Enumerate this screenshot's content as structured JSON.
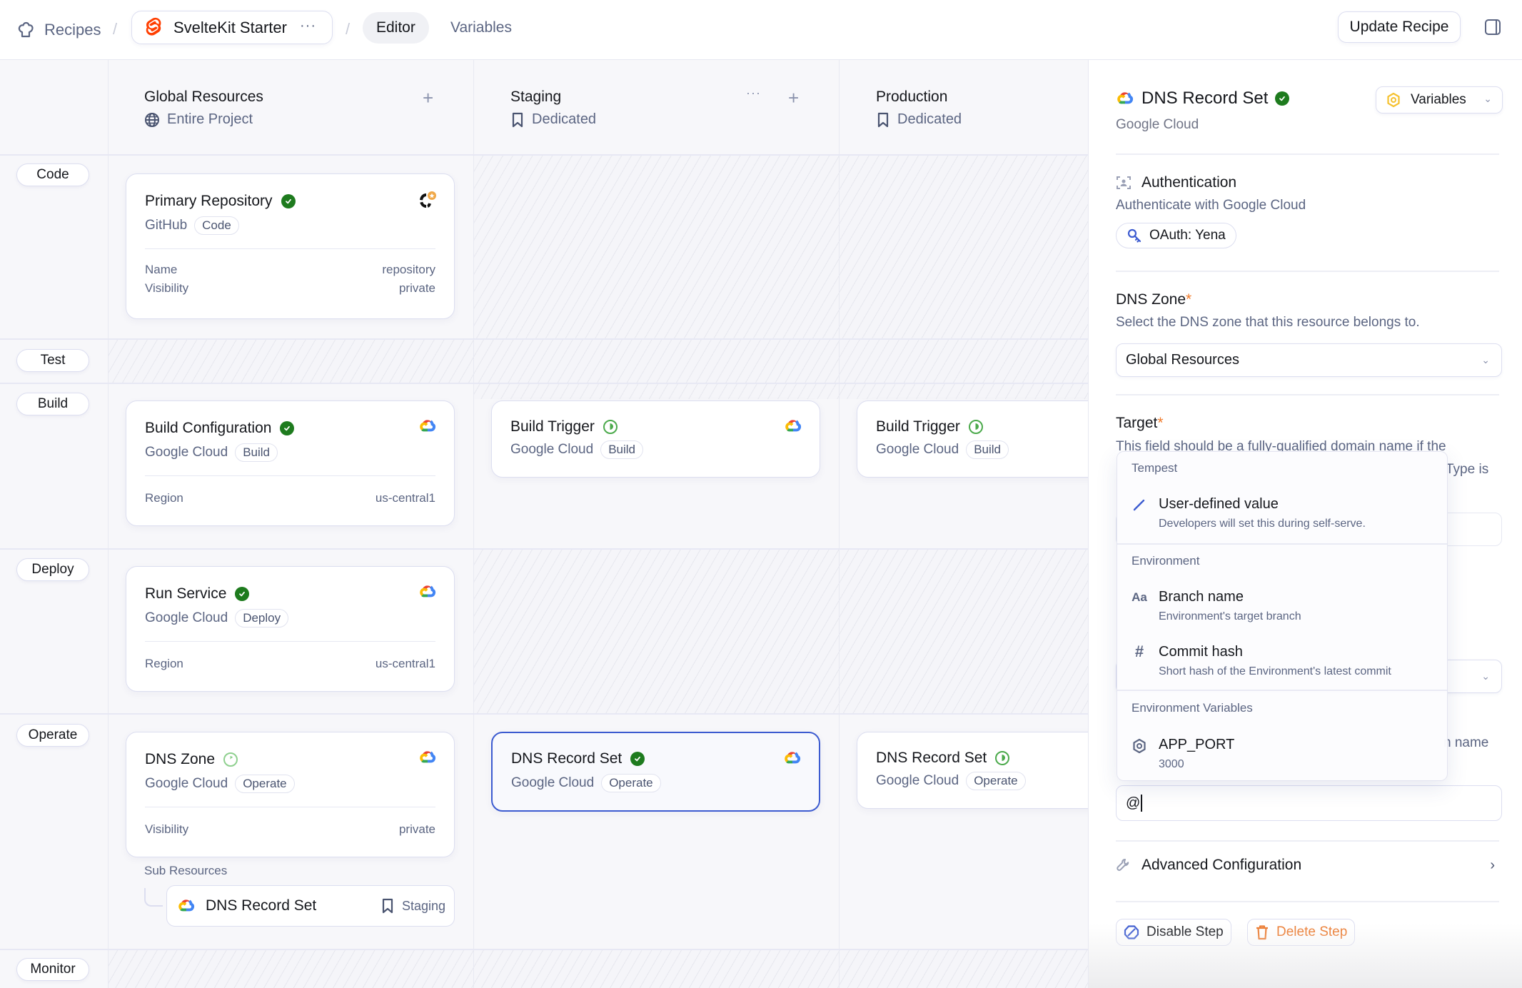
{
  "topbar": {
    "breadcrumb_root": "Recipes",
    "project_name": "SvelteKit Starter",
    "project_menu": "···",
    "separator": "/",
    "tabs": [
      {
        "label": "Editor",
        "active": true
      },
      {
        "label": "Variables",
        "active": false
      }
    ],
    "update_button": "Update Recipe"
  },
  "columns": [
    {
      "title": "Global Resources",
      "subtitle": "Entire Project",
      "icon": "globe-icon",
      "add": "+"
    },
    {
      "title": "Staging",
      "subtitle": "Dedicated",
      "icon": "bookmark-icon",
      "more": "···",
      "add": "+"
    },
    {
      "title": "Production",
      "subtitle": "Dedicated",
      "icon": "bookmark-icon"
    }
  ],
  "rows": [
    "Code",
    "Test",
    "Build",
    "Deploy",
    "Operate",
    "Monitor"
  ],
  "cards": {
    "primary_repo": {
      "title": "Primary Repository",
      "status": "done",
      "provider": "GitHub",
      "tag": "Code",
      "props": [
        {
          "label": "Name",
          "value": "repository"
        },
        {
          "label": "Visibility",
          "value": "private"
        }
      ]
    },
    "build_config": {
      "title": "Build Configuration",
      "status": "done",
      "provider": "Google Cloud",
      "tag": "Build",
      "props": [
        {
          "label": "Region",
          "value": "us-central1"
        }
      ]
    },
    "build_trigger_staging": {
      "title": "Build Trigger",
      "status": "in-progress",
      "provider": "Google Cloud",
      "tag": "Build"
    },
    "build_trigger_production": {
      "title": "Build Trigger",
      "status": "in-progress",
      "provider": "Google Cloud",
      "tag": "Build"
    },
    "run_service": {
      "title": "Run Service",
      "status": "done",
      "provider": "Google Cloud",
      "tag": "Deploy",
      "props": [
        {
          "label": "Region",
          "value": "us-central1"
        }
      ]
    },
    "dns_zone": {
      "title": "DNS Zone",
      "status": "pending",
      "provider": "Google Cloud",
      "tag": "Operate",
      "props": [
        {
          "label": "Visibility",
          "value": "private"
        }
      ]
    },
    "dns_record_staging": {
      "title": "DNS Record Set",
      "status": "done",
      "provider": "Google Cloud",
      "tag": "Operate",
      "selected": true
    },
    "dns_record_production": {
      "title": "DNS Record Set",
      "status": "in-progress",
      "provider": "Google Cloud",
      "tag": "Operate"
    }
  },
  "sub_resources": {
    "label": "Sub Resources",
    "items": [
      {
        "title": "DNS Record Set",
        "environment": "Staging"
      }
    ]
  },
  "panel": {
    "title": "DNS Record Set",
    "status": "done",
    "provider": "Google Cloud",
    "variables_button": "Variables",
    "auth": {
      "title": "Authentication",
      "description": "Authenticate with Google Cloud",
      "credential": "OAuth: Yena"
    },
    "dns_zone": {
      "label": "DNS Zone",
      "required": "*",
      "description": "Select the DNS zone that this resource belongs to.",
      "value": "Global Resources"
    },
    "target": {
      "label": "Target",
      "required": "*",
      "description_line1": "This field should be a fully-qualified domain name if the",
      "description_partial": "Type is"
    },
    "hidden_field_partial": "n name",
    "input_value": "@",
    "advanced": "Advanced Configuration",
    "disable_button": "Disable Step",
    "delete_button": "Delete Step"
  },
  "menu": {
    "groups": [
      {
        "label": "Tempest",
        "items": [
          {
            "icon": "pencil-icon",
            "title": "User-defined value",
            "subtitle": "Developers will set this during self-serve."
          }
        ]
      },
      {
        "label": "Environment",
        "items": [
          {
            "icon": "text-icon",
            "title": "Branch name",
            "subtitle": "Environment's target branch"
          },
          {
            "icon": "hash-icon",
            "title": "Commit hash",
            "subtitle": "Short hash of the Environment's latest commit"
          }
        ]
      },
      {
        "label": "Environment Variables",
        "items": [
          {
            "icon": "hexagon-icon",
            "title": "APP_PORT",
            "subtitle": "3000"
          }
        ]
      }
    ]
  },
  "colors": {
    "accent": "#3c5bd0",
    "success": "#1e7b1e",
    "in_progress": "#4caa4c",
    "required": "#f07a2a",
    "danger": "#ec7a2e",
    "svelte": "#ff3e00"
  }
}
